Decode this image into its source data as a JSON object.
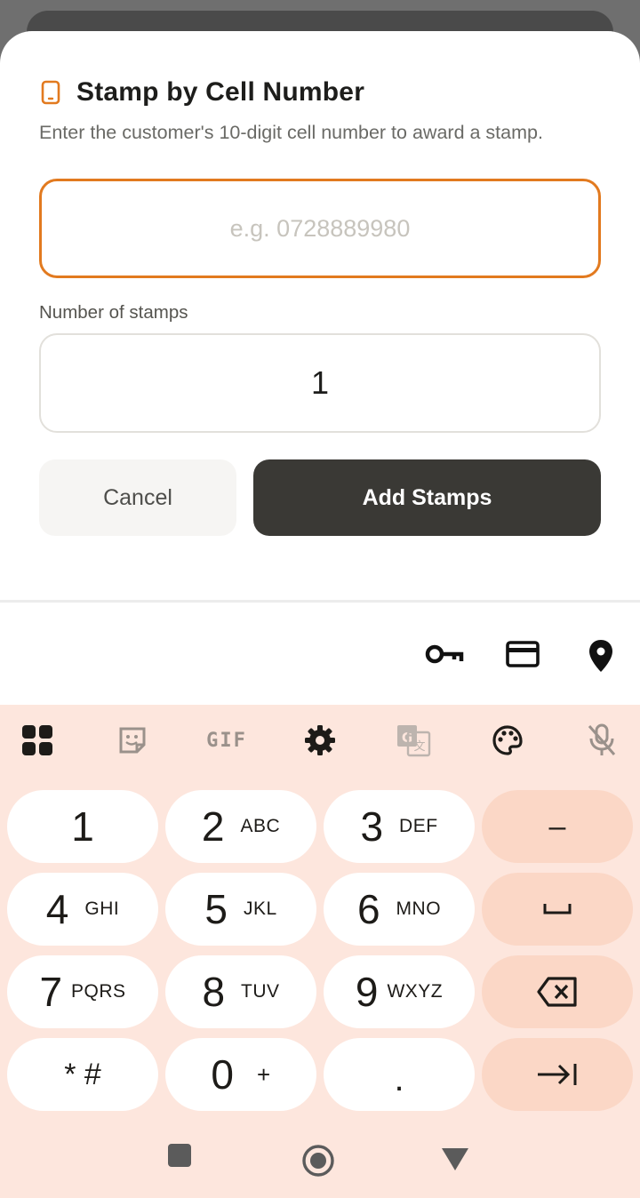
{
  "dialog": {
    "title": "Stamp by Cell Number",
    "subtitle": "Enter the customer's 10-digit cell number to award a stamp.",
    "cell_placeholder": "e.g. 0728889980",
    "cell_value": "",
    "stamps_label": "Number of stamps",
    "stamps_value": "1",
    "cancel_label": "Cancel",
    "add_label": "Add Stamps",
    "accent_color": "#e27a1f",
    "primary_button_color": "#3a3935"
  },
  "autofill": {
    "icons": [
      "key-icon",
      "credit-card-icon",
      "location-pin-icon"
    ]
  },
  "keyboard": {
    "toolbar": [
      "apps-grid-icon",
      "sticker-icon",
      "gif-icon",
      "settings-gear-icon",
      "translate-icon",
      "palette-icon",
      "mic-off-icon"
    ],
    "gif_label": "GIF",
    "keys": [
      {
        "num": "1",
        "letters": ""
      },
      {
        "num": "2",
        "letters": "ABC"
      },
      {
        "num": "3",
        "letters": "DEF"
      },
      {
        "num": "4",
        "letters": "GHI"
      },
      {
        "num": "5",
        "letters": "JKL"
      },
      {
        "num": "6",
        "letters": "MNO"
      },
      {
        "num": "7",
        "letters": "PQRS"
      },
      {
        "num": "8",
        "letters": "TUV"
      },
      {
        "num": "9",
        "letters": "WXYZ"
      },
      {
        "num": "* #",
        "letters": ""
      },
      {
        "num": "0",
        "letters": "+"
      },
      {
        "num": ".",
        "letters": ""
      }
    ],
    "action_keys": [
      "minus-icon",
      "space-icon",
      "backspace-icon",
      "tab-next-icon"
    ],
    "minus_label": "–",
    "background_color": "#fde6dd",
    "action_key_color": "#fbd7c6"
  },
  "navbar": {
    "icons": [
      "recents-square-icon",
      "home-circle-icon",
      "back-triangle-icon"
    ]
  }
}
